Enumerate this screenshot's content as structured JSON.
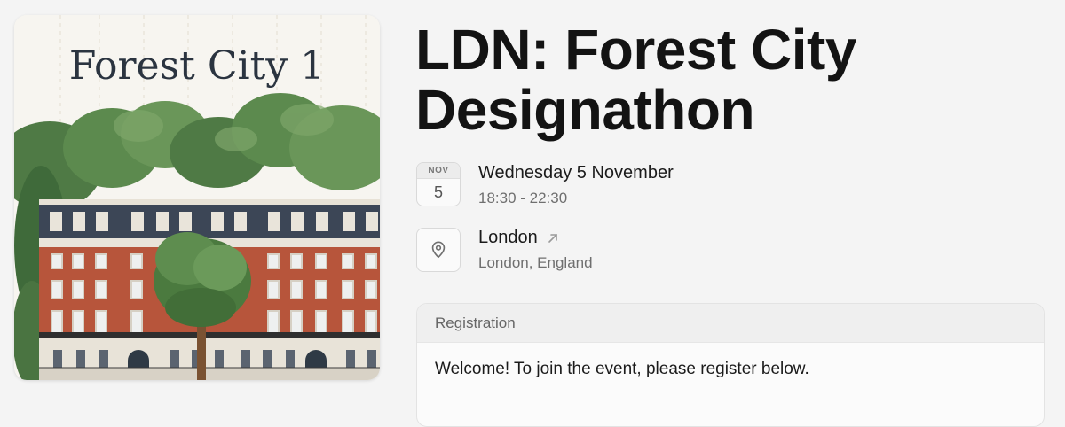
{
  "cover": {
    "title": "Forest City 1",
    "image_alt": "Illustration of a red-brick Georgian terrace with trees"
  },
  "event": {
    "title_line1": "LDN: Forest City",
    "title_line2": "Designathon"
  },
  "date": {
    "month": "NOV",
    "day": "5",
    "full": "Wednesday 5 November",
    "time": "18:30 - 22:30"
  },
  "location": {
    "name": "London",
    "region": "London, England",
    "icon": "map-pin-icon",
    "link_icon": "arrow-up-right-icon"
  },
  "registration": {
    "header": "Registration",
    "message": "Welcome! To join the event, please register below."
  }
}
